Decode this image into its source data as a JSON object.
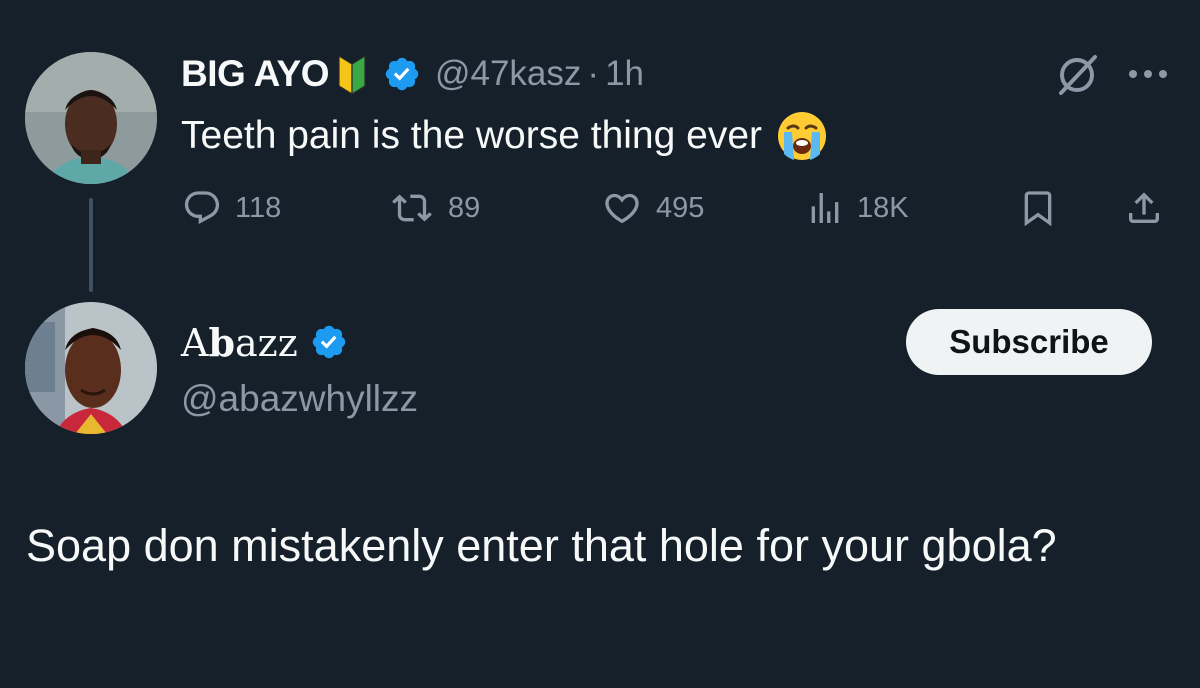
{
  "original_tweet": {
    "display_name": "BIG AYO",
    "handle": "@47kasz",
    "separator": "·",
    "time": "1h",
    "text": "Teeth pain is the worse thing ever",
    "emoji": "loudly-crying-face",
    "badges": [
      "beginner-icon",
      "verified-badge-icon"
    ],
    "stats": {
      "replies": "118",
      "reposts": "89",
      "likes": "495",
      "views": "18K"
    }
  },
  "reply": {
    "display_name_prefix": "A",
    "display_name_bold": "b",
    "display_name_suffix": "azz",
    "handle": "@abazwhyllzz",
    "subscribe_label": "Subscribe",
    "text": "Soap don mistakenly enter that hole for your gbola?"
  },
  "colors": {
    "background": "#15202b",
    "text": "#f7f9f9",
    "secondary_text": "#8b98a5",
    "verified": "#1d9bf0",
    "button_bg": "#eff3f4"
  }
}
